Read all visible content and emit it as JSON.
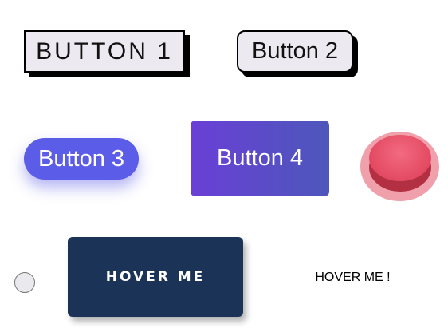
{
  "buttons": {
    "button1": "BUTTON 1",
    "button2": "Button 2",
    "button3": "Button 3",
    "button4": "Button 4",
    "hover_dark": "HOVER ME",
    "hover_plain": "HOVER ME !"
  },
  "colors": {
    "button3_bg": "#5b5ce8",
    "button4_gradient_start": "#6a3fd6",
    "button4_gradient_end": "#4d57bb",
    "red_button": "#e24a62",
    "hover_dark_bg": "#1b3356"
  }
}
